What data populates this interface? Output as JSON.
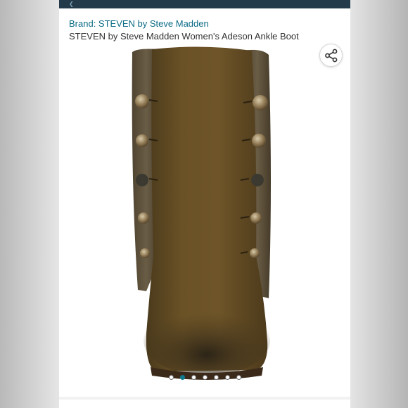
{
  "product": {
    "brand_label": "Brand: STEVEN by Steve Madden",
    "title": "STEVEN by Steve Madden Women's Adeson Ankle Boot"
  },
  "carousel": {
    "image_count": 7,
    "active_index": 1
  },
  "icons": {
    "share": "share-icon"
  },
  "colors": {
    "link": "#0b6b86",
    "active_dot": "#0f7a8f",
    "header": "#233a4a"
  }
}
